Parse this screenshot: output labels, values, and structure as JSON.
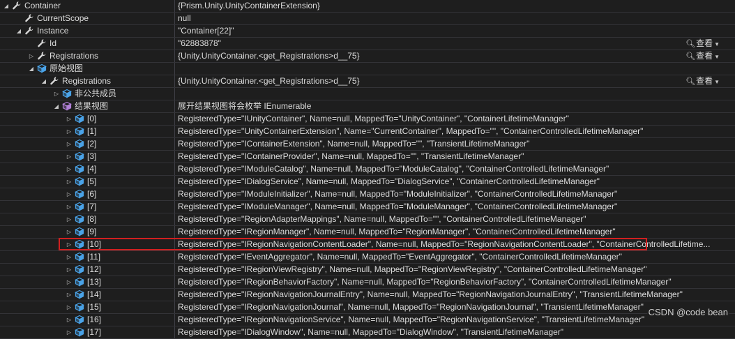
{
  "rows": [
    {
      "label": "Container",
      "value": "{Prism.Unity.UnityContainerExtension}",
      "indent": 0,
      "expand": "expanded",
      "icon": "wrench-icon",
      "view": false
    },
    {
      "label": "CurrentScope",
      "value": "null",
      "indent": 1,
      "expand": "none",
      "icon": "wrench-icon",
      "view": false
    },
    {
      "label": "Instance",
      "value": "\"Container[22]\"",
      "indent": 1,
      "expand": "expanded",
      "icon": "wrench-icon",
      "view": false
    },
    {
      "label": "Id",
      "value": "\"62883878\"",
      "indent": 2,
      "expand": "none",
      "icon": "wrench-icon",
      "view": true
    },
    {
      "label": "Registrations",
      "value": "{Unity.UnityContainer.<get_Registrations>d__75}",
      "indent": 2,
      "expand": "collapsed",
      "icon": "wrench-icon",
      "view": true
    },
    {
      "label": "原始视图",
      "value": "",
      "indent": 2,
      "expand": "expanded",
      "icon": "cube-blue-icon",
      "view": false
    },
    {
      "label": "Registrations",
      "value": "{Unity.UnityContainer.<get_Registrations>d__75}",
      "indent": 3,
      "expand": "expanded",
      "icon": "wrench-icon",
      "view": true
    },
    {
      "label": "非公共成员",
      "value": "",
      "indent": 4,
      "expand": "collapsed",
      "icon": "cube-blue-icon",
      "view": false
    },
    {
      "label": "结果视图",
      "value": "展开结果视图将会枚举 IEnumerable",
      "indent": 4,
      "expand": "expanded",
      "icon": "cube-purple-icon",
      "view": false
    },
    {
      "label": "[0]",
      "value": "RegisteredType=\"IUnityContainer\",    Name=null,    MappedTo=\"UnityContainer\",    \"ContainerLifetimeManager\"",
      "indent": 5,
      "expand": "collapsed",
      "icon": "cube-blue-icon",
      "view": false
    },
    {
      "label": "[1]",
      "value": "RegisteredType=\"UnityContainerExtension\",    Name=\"CurrentContainer\",    MappedTo=\"\",    \"ContainerControlledLifetimeManager\"",
      "indent": 5,
      "expand": "collapsed",
      "icon": "cube-blue-icon",
      "view": false
    },
    {
      "label": "[2]",
      "value": "RegisteredType=\"IContainerExtension\",    Name=null,    MappedTo=\"\",    \"TransientLifetimeManager\"",
      "indent": 5,
      "expand": "collapsed",
      "icon": "cube-blue-icon",
      "view": false
    },
    {
      "label": "[3]",
      "value": "RegisteredType=\"IContainerProvider\",    Name=null,    MappedTo=\"\",    \"TransientLifetimeManager\"",
      "indent": 5,
      "expand": "collapsed",
      "icon": "cube-blue-icon",
      "view": false
    },
    {
      "label": "[4]",
      "value": "RegisteredType=\"IModuleCatalog\",    Name=null,    MappedTo=\"ModuleCatalog\",    \"ContainerControlledLifetimeManager\"",
      "indent": 5,
      "expand": "collapsed",
      "icon": "cube-blue-icon",
      "view": false
    },
    {
      "label": "[5]",
      "value": "RegisteredType=\"IDialogService\",    Name=null,    MappedTo=\"DialogService\",    \"ContainerControlledLifetimeManager\"",
      "indent": 5,
      "expand": "collapsed",
      "icon": "cube-blue-icon",
      "view": false
    },
    {
      "label": "[6]",
      "value": "RegisteredType=\"IModuleInitializer\",    Name=null,    MappedTo=\"ModuleInitializer\",    \"ContainerControlledLifetimeManager\"",
      "indent": 5,
      "expand": "collapsed",
      "icon": "cube-blue-icon",
      "view": false
    },
    {
      "label": "[7]",
      "value": "RegisteredType=\"IModuleManager\",    Name=null,    MappedTo=\"ModuleManager\",    \"ContainerControlledLifetimeManager\"",
      "indent": 5,
      "expand": "collapsed",
      "icon": "cube-blue-icon",
      "view": false
    },
    {
      "label": "[8]",
      "value": "RegisteredType=\"RegionAdapterMappings\",    Name=null,    MappedTo=\"\",    \"ContainerControlledLifetimeManager\"",
      "indent": 5,
      "expand": "collapsed",
      "icon": "cube-blue-icon",
      "view": false
    },
    {
      "label": "[9]",
      "value": "RegisteredType=\"IRegionManager\",    Name=null,    MappedTo=\"RegionManager\",    \"ContainerControlledLifetimeManager\"",
      "indent": 5,
      "expand": "collapsed",
      "icon": "cube-blue-icon",
      "view": false
    },
    {
      "label": "[10]",
      "value": "RegisteredType=\"IRegionNavigationContentLoader\",    Name=null,    MappedTo=\"RegionNavigationContentLoader\",    \"ContainerControlledLifetime...",
      "indent": 5,
      "expand": "collapsed",
      "icon": "cube-blue-icon",
      "view": false
    },
    {
      "label": "[11]",
      "value": "RegisteredType=\"IEventAggregator\",    Name=null,    MappedTo=\"EventAggregator\",    \"ContainerControlledLifetimeManager\"",
      "indent": 5,
      "expand": "collapsed",
      "icon": "cube-blue-icon",
      "view": false
    },
    {
      "label": "[12]",
      "value": "RegisteredType=\"IRegionViewRegistry\",    Name=null,    MappedTo=\"RegionViewRegistry\",    \"ContainerControlledLifetimeManager\"",
      "indent": 5,
      "expand": "collapsed",
      "icon": "cube-blue-icon",
      "view": false
    },
    {
      "label": "[13]",
      "value": "RegisteredType=\"IRegionBehaviorFactory\",    Name=null,    MappedTo=\"RegionBehaviorFactory\",    \"ContainerControlledLifetimeManager\"",
      "indent": 5,
      "expand": "collapsed",
      "icon": "cube-blue-icon",
      "view": false
    },
    {
      "label": "[14]",
      "value": "RegisteredType=\"IRegionNavigationJournalEntry\",    Name=null,    MappedTo=\"RegionNavigationJournalEntry\",    \"TransientLifetimeManager\"",
      "indent": 5,
      "expand": "collapsed",
      "icon": "cube-blue-icon",
      "view": false
    },
    {
      "label": "[15]",
      "value": "RegisteredType=\"IRegionNavigationJournal\",    Name=null,    MappedTo=\"RegionNavigationJournal\",    \"TransientLifetimeManager\"",
      "indent": 5,
      "expand": "collapsed",
      "icon": "cube-blue-icon",
      "view": false
    },
    {
      "label": "[16]",
      "value": "RegisteredType=\"IRegionNavigationService\",    Name=null,    MappedTo=\"RegionNavigationService\",    \"TransientLifetimeManager\"",
      "indent": 5,
      "expand": "collapsed",
      "icon": "cube-blue-icon",
      "view": false
    },
    {
      "label": "[17]",
      "value": "RegisteredType=\"IDialogWindow\",    Name=null,    MappedTo=\"DialogWindow\",    \"TransientLifetimeManager\"",
      "indent": 5,
      "expand": "collapsed",
      "icon": "cube-blue-icon",
      "view": false
    }
  ],
  "view_button_label": "查看",
  "watermark": "CSDN @code bean",
  "colors": {
    "background": "#1e1e1e",
    "text": "#dcdcdc",
    "grid_line": "#333337",
    "highlight_border": "#d02020",
    "wrench": "#d8d8d8",
    "cube_blue": "#4aa3e8",
    "cube_purple": "#b180d7"
  }
}
